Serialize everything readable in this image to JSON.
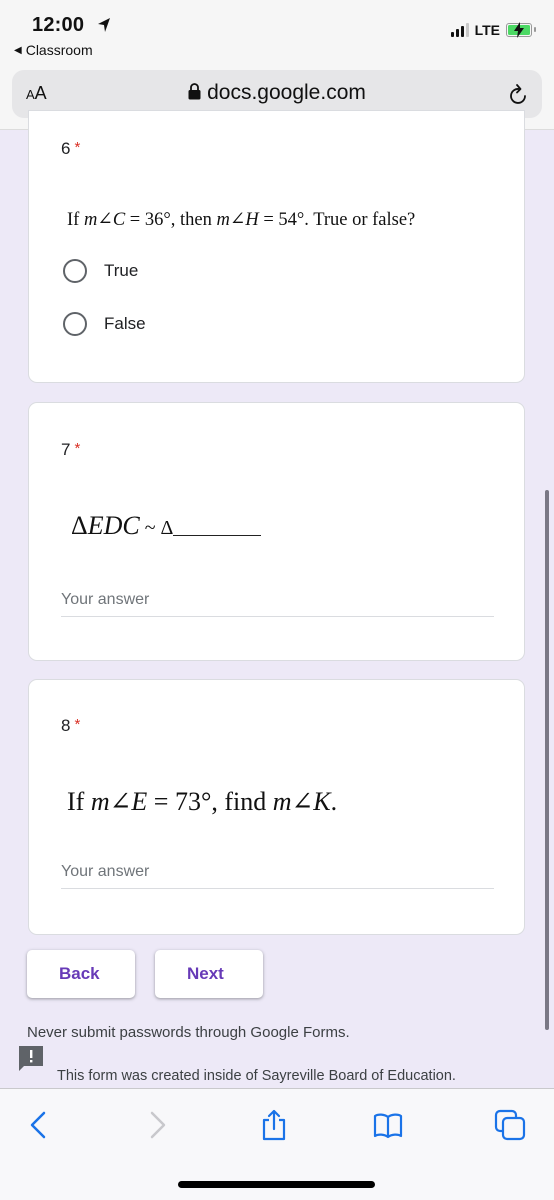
{
  "status_bar": {
    "time": "12:00",
    "back_app": "Classroom",
    "network": "LTE",
    "battery_charging": true,
    "battery_color": "#4cd964",
    "signal_bars_active": 3,
    "signal_bars_total": 4
  },
  "browser": {
    "text_size_button": "AA",
    "url": "docs.google.com",
    "secure": true
  },
  "questions": [
    {
      "number": "6",
      "required_mark": "*",
      "prompt_parts": {
        "if": "If ",
        "angle1": "m∠C",
        "eq1": " = 36°, then ",
        "angle2": "m∠H",
        "eq2": " = 54°. True or false?"
      },
      "type": "radio",
      "options": [
        "True",
        "False"
      ]
    },
    {
      "number": "7",
      "required_mark": "*",
      "prompt_parts": {
        "delta1": "Δ",
        "triangle": "EDC",
        "similar": " ~ Δ"
      },
      "type": "short_answer",
      "placeholder": "Your answer",
      "value": ""
    },
    {
      "number": "8",
      "required_mark": "*",
      "prompt_parts": {
        "if": "If ",
        "angle1": "m∠E",
        "eq1": " = 73°, find ",
        "angle2": "m∠K",
        "end": "."
      },
      "type": "short_answer",
      "placeholder": "Your answer",
      "value": ""
    }
  ],
  "buttons": {
    "back": "Back",
    "next": "Next",
    "accent_color": "#673ab7"
  },
  "footer": {
    "password_notice": "Never submit passwords through Google Forms.",
    "created_notice": "This form was created inside of Sayreville Board of Education."
  },
  "toolbar": {
    "icons": [
      "back-icon",
      "forward-icon",
      "share-icon",
      "bookmarks-icon",
      "tabs-icon"
    ],
    "icon_color": "#1a73e8"
  }
}
